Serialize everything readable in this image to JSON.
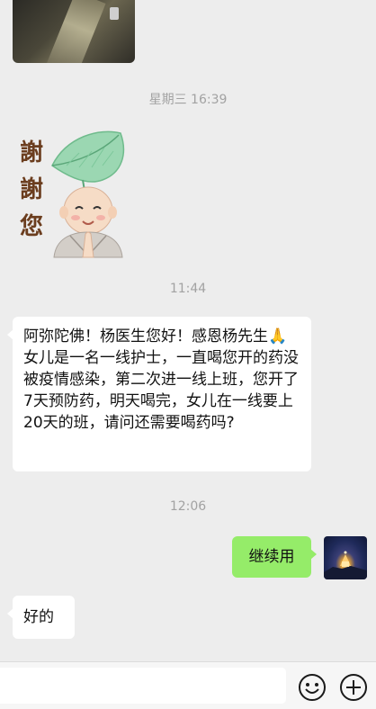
{
  "chat": {
    "timestamps": {
      "t1": "星期三 16:39",
      "t2": "11:44",
      "t3": "12:06"
    },
    "sticker": {
      "text": [
        "謝",
        "謝",
        "您"
      ]
    },
    "messages": {
      "incoming_1": "阿弥陀佛！杨医生您好！感恩杨先生🙏女儿是一名一线护士，一直喝您开的药没被疫情感染，第二次进一线上班，您开了7天预防药，明天喝完，女儿在一线要上20天的班，请问还需要喝药吗?",
      "outgoing_1": "继续用",
      "incoming_2": "好的"
    }
  },
  "toolbar": {
    "input_value": "",
    "emoji_icon": "smiley-icon",
    "plus_icon": "plus-circle-icon"
  },
  "colors": {
    "background": "#ededed",
    "incoming_bubble": "#ffffff",
    "outgoing_bubble": "#95ec69",
    "timestamp_text": "#a2a2a2"
  }
}
